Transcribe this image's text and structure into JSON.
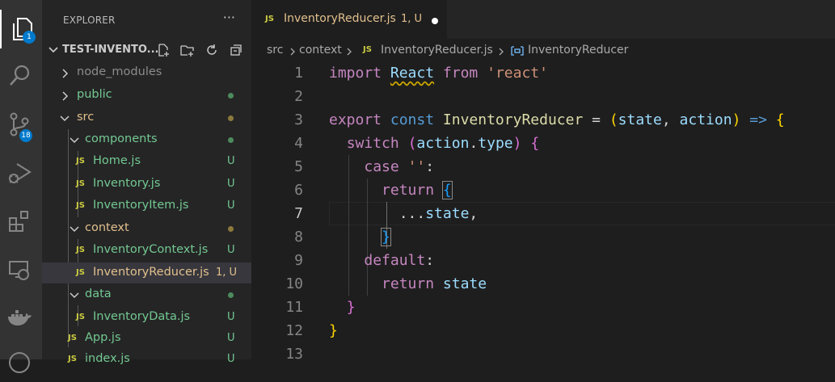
{
  "activity_bar": {
    "items": [
      {
        "name": "explorer",
        "icon": "files-icon",
        "badge": "1"
      },
      {
        "name": "search",
        "icon": "search-icon"
      },
      {
        "name": "source-control",
        "icon": "source-control-icon",
        "badge": "18"
      },
      {
        "name": "run-debug",
        "icon": "run-debug-icon"
      },
      {
        "name": "extensions",
        "icon": "extensions-icon"
      },
      {
        "name": "remote-explorer",
        "icon": "remote-explorer-icon"
      },
      {
        "name": "docker",
        "icon": "docker-icon"
      }
    ]
  },
  "sidebar": {
    "title": "EXPLORER",
    "more": "···",
    "project": "TEST-INVENTO...",
    "tree": [
      {
        "label": "node_modules",
        "type": "folder",
        "status": ""
      },
      {
        "label": "public",
        "type": "folder",
        "status": "",
        "dot": "#4d8b5d"
      },
      {
        "label": "src",
        "type": "folder",
        "status": "",
        "dot": "#8b7a3a"
      },
      {
        "label": "components",
        "type": "folder",
        "status": "",
        "dot": "#4d8b5d"
      },
      {
        "label": "Home.js",
        "type": "js",
        "status": "U"
      },
      {
        "label": "Inventory.js",
        "type": "js",
        "status": "U"
      },
      {
        "label": "InventoryItem.js",
        "type": "js",
        "status": "U"
      },
      {
        "label": "context",
        "type": "folder",
        "status": "",
        "dot": "#8b7a3a"
      },
      {
        "label": "InventoryContext.js",
        "type": "js",
        "status": "U"
      },
      {
        "label": "InventoryReducer.js",
        "type": "js",
        "status": "1, U"
      },
      {
        "label": "data",
        "type": "folder",
        "status": "",
        "dot": "#4d8b5d"
      },
      {
        "label": "InventoryData.js",
        "type": "js",
        "status": "U"
      },
      {
        "label": "App.js",
        "type": "js",
        "status": "U"
      },
      {
        "label": "index.js",
        "type": "js",
        "status": "U"
      }
    ]
  },
  "editor": {
    "tab": {
      "label": "InventoryReducer.js",
      "status": "1, U",
      "file_icon": "JS"
    },
    "breadcrumb": [
      "src",
      "context",
      "InventoryReducer.js",
      "InventoryReducer"
    ],
    "lines": [
      "1",
      "2",
      "3",
      "4",
      "5",
      "6",
      "7",
      "8",
      "9",
      "10",
      "11",
      "12",
      "13"
    ],
    "code": {
      "l1_import": "import",
      "l1_react": "React",
      "l1_from": "from",
      "l1_str": "'react'",
      "l3_export": "export",
      "l3_const": "const",
      "l3_name": "InventoryReducer",
      "l3_eq": " = ",
      "l3_state": "state",
      "l3_action": "action",
      "l3_arrow": "=>",
      "l4_switch": "switch",
      "l4_action": "action",
      "l4_type": "type",
      "l5_case": "case",
      "l5_str": "''",
      "l6_return": "return",
      "l7_spread": "...",
      "l7_state": "state",
      "l9_default": "default",
      "l10_return": "return",
      "l10_state": "state"
    }
  }
}
